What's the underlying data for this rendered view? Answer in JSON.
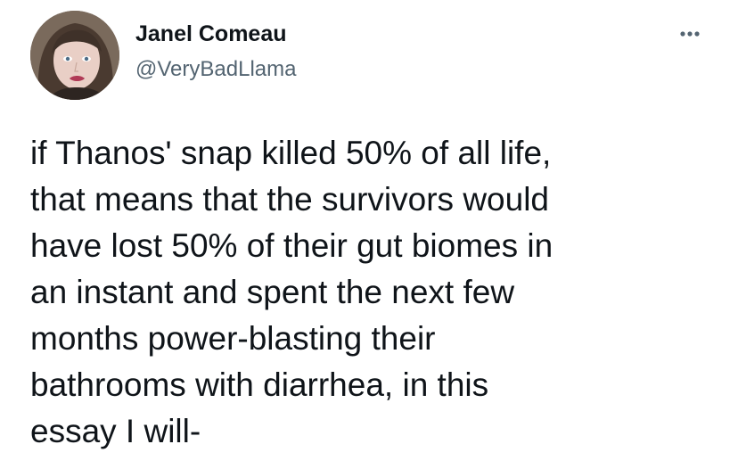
{
  "author": {
    "display_name": "Janel Comeau",
    "handle": "@VeryBadLlama"
  },
  "more_icon": "ellipsis-horizontal-icon",
  "tweet": {
    "lines": [
      "if Thanos' snap killed 50% of all life,",
      "that means that the survivors would",
      "have lost 50% of their gut biomes in",
      "an instant and spent the next few",
      "months power-blasting their",
      "bathrooms with diarrhea, in this",
      "essay I will-"
    ]
  },
  "colors": {
    "text": "#0f1419",
    "secondary": "#536471",
    "background": "#ffffff"
  }
}
